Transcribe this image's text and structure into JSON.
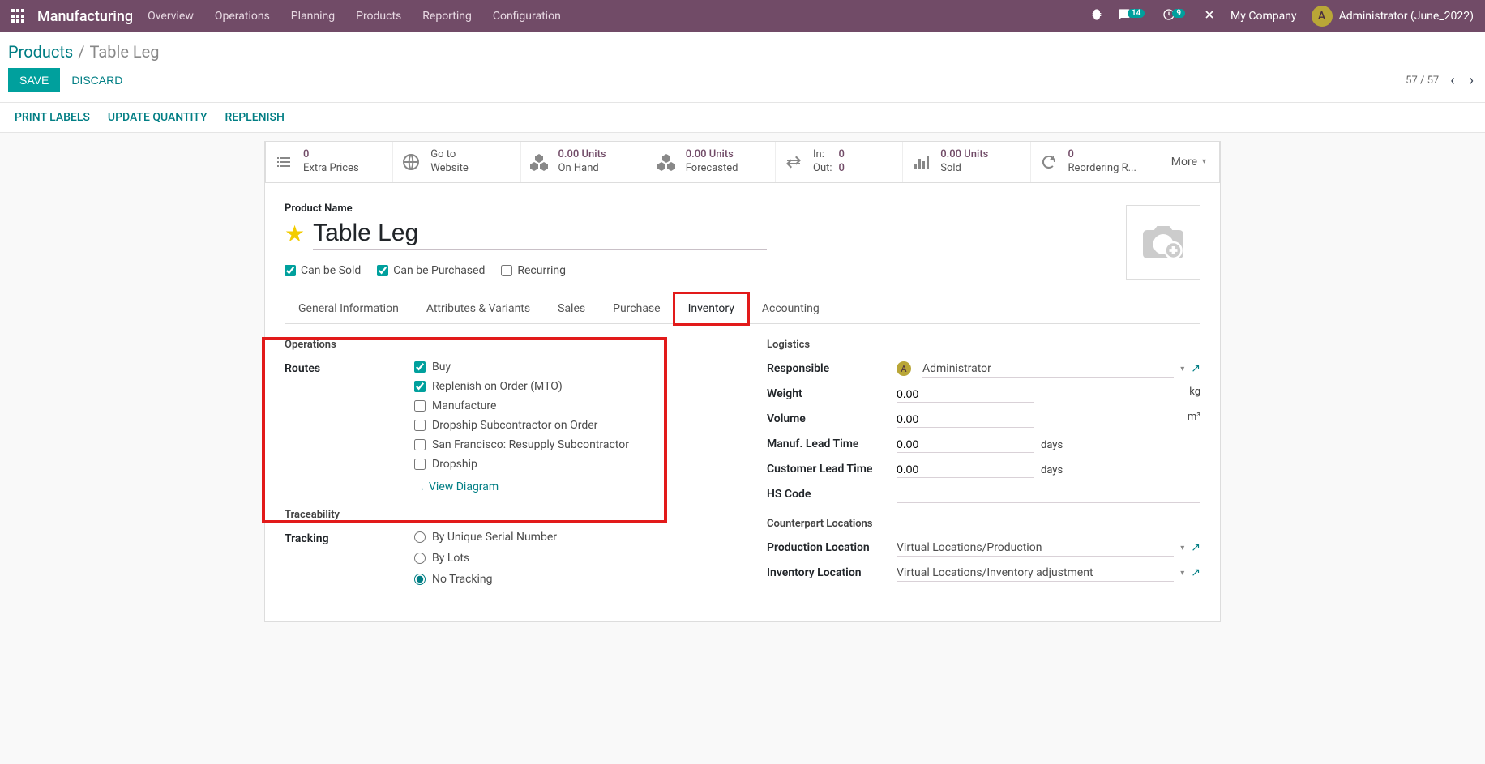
{
  "topbar": {
    "brand": "Manufacturing",
    "menu": [
      "Overview",
      "Operations",
      "Planning",
      "Products",
      "Reporting",
      "Configuration"
    ],
    "chat_badge": "14",
    "activity_badge": "9",
    "company": "My Company",
    "user_initial": "A",
    "user": "Administrator (June_2022)"
  },
  "breadcrumb": {
    "parent": "Products",
    "active": "Table Leg"
  },
  "actions": {
    "save": "SAVE",
    "discard": "DISCARD",
    "pager": "57 / 57"
  },
  "toolbar": {
    "print": "PRINT LABELS",
    "update": "UPDATE QUANTITY",
    "replenish": "REPLENISH"
  },
  "stats": {
    "extra_prices": {
      "val": "0",
      "lbl": "Extra Prices"
    },
    "website": {
      "line1": "Go to",
      "line2": "Website"
    },
    "on_hand": {
      "val": "0.00 Units",
      "lbl": "On Hand"
    },
    "forecast": {
      "val": "0.00 Units",
      "lbl": "Forecasted"
    },
    "inout": {
      "in_l": "In:",
      "in_v": "0",
      "out_l": "Out:",
      "out_v": "0"
    },
    "sold": {
      "val": "0.00 Units",
      "lbl": "Sold"
    },
    "reorder": {
      "val": "0",
      "lbl": "Reordering R..."
    },
    "more": "More"
  },
  "product": {
    "name_label": "Product Name",
    "name": "Table Leg",
    "can_be_sold": "Can be Sold",
    "can_be_purchased": "Can be Purchased",
    "recurring": "Recurring"
  },
  "tabs": [
    "General Information",
    "Attributes & Variants",
    "Sales",
    "Purchase",
    "Inventory",
    "Accounting"
  ],
  "inventory": {
    "operations_title": "Operations",
    "routes_label": "Routes",
    "routes": [
      {
        "label": "Buy",
        "checked": true
      },
      {
        "label": "Replenish on Order (MTO)",
        "checked": true
      },
      {
        "label": "Manufacture",
        "checked": false
      },
      {
        "label": "Dropship Subcontractor on Order",
        "checked": false
      },
      {
        "label": "San Francisco: Resupply Subcontractor",
        "checked": false
      },
      {
        "label": "Dropship",
        "checked": false
      }
    ],
    "view_diagram": "View Diagram",
    "traceability_title": "Traceability",
    "tracking_label": "Tracking",
    "tracking_options": [
      "By Unique Serial Number",
      "By Lots",
      "No Tracking"
    ],
    "logistics_title": "Logistics",
    "responsible_label": "Responsible",
    "responsible_initial": "A",
    "responsible": "Administrator",
    "weight_label": "Weight",
    "weight": "0.00",
    "weight_unit": "kg",
    "volume_label": "Volume",
    "volume": "0.00",
    "volume_unit": "m³",
    "manuf_lead_label": "Manuf. Lead Time",
    "manuf_lead": "0.00",
    "days": "days",
    "cust_lead_label": "Customer Lead Time",
    "cust_lead": "0.00",
    "hs_label": "HS Code",
    "hs": "",
    "counterpart_title": "Counterpart Locations",
    "prod_loc_label": "Production Location",
    "prod_loc": "Virtual Locations/Production",
    "inv_loc_label": "Inventory Location",
    "inv_loc": "Virtual Locations/Inventory adjustment"
  }
}
